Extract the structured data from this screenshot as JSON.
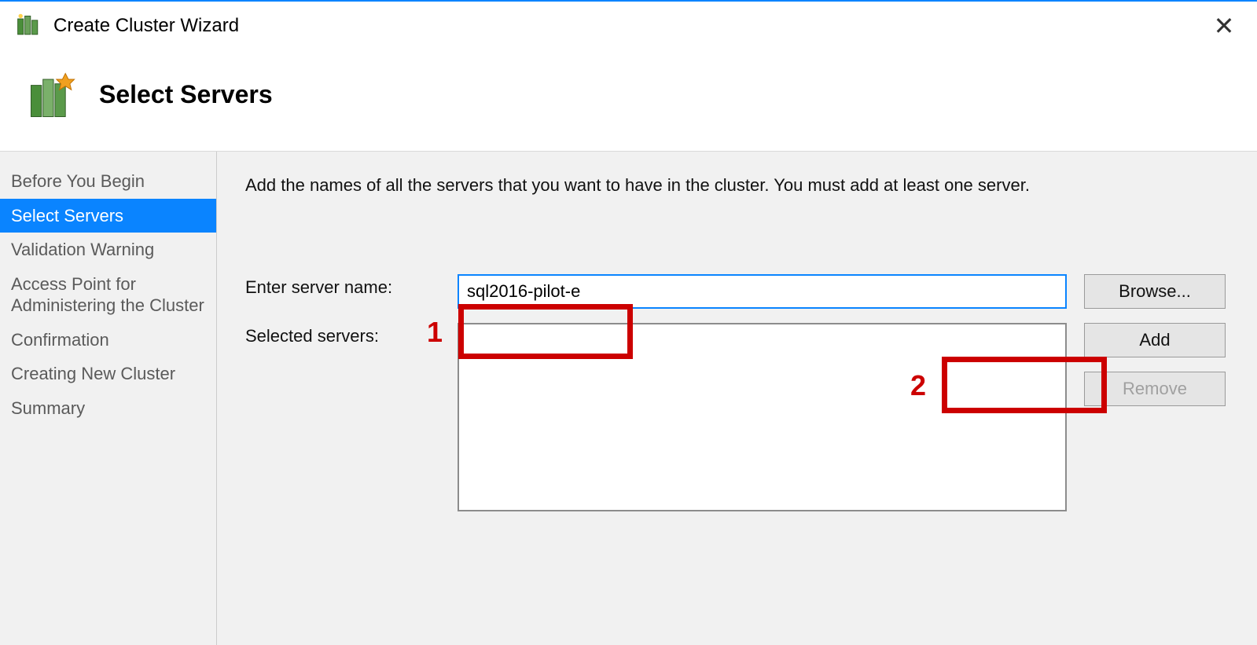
{
  "titlebar": {
    "title": "Create Cluster Wizard"
  },
  "header": {
    "page_title": "Select Servers"
  },
  "sidebar": {
    "items": [
      {
        "label": "Before You Begin"
      },
      {
        "label": "Select Servers"
      },
      {
        "label": "Validation Warning"
      },
      {
        "label": "Access Point for Administering the Cluster"
      },
      {
        "label": "Confirmation"
      },
      {
        "label": "Creating New Cluster"
      },
      {
        "label": "Summary"
      }
    ],
    "active_index": 1
  },
  "main": {
    "instruction": "Add the names of all the servers that you want to have in the cluster. You must add at least one server.",
    "server_name_label": "Enter server name:",
    "server_name_value": "sql2016-pilot-e",
    "selected_servers_label": "Selected servers:",
    "browse_label": "Browse...",
    "add_label": "Add",
    "remove_label": "Remove"
  },
  "annotations": {
    "marker1": "1",
    "marker2": "2"
  }
}
